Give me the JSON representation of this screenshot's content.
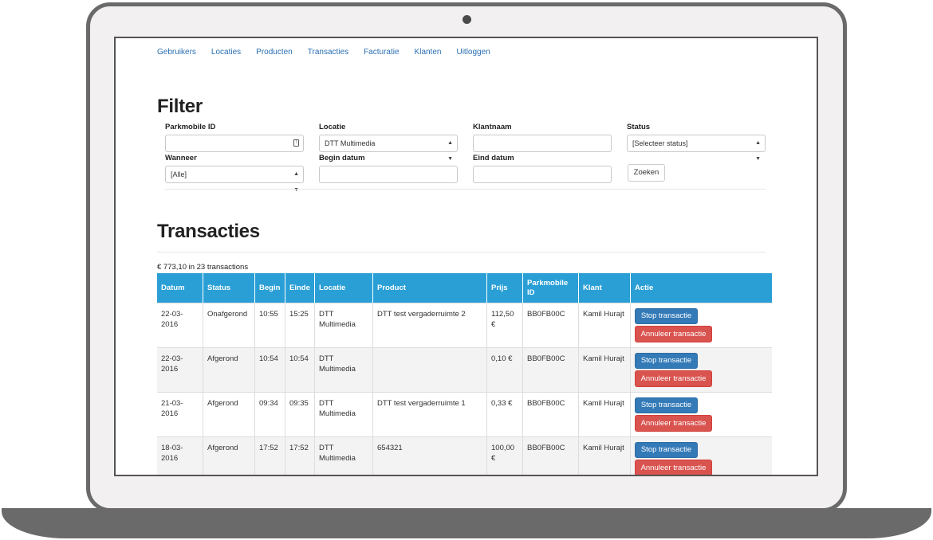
{
  "nav": [
    "Gebruikers",
    "Locaties",
    "Producten",
    "Transacties",
    "Facturatie",
    "Klanten",
    "Uitloggen"
  ],
  "filter": {
    "title": "Filter",
    "parkmobile_label": "Parkmobile ID",
    "parkmobile_value": "",
    "locatie_label": "Locatie",
    "locatie_value": "DTT Multimedia",
    "klantnaam_label": "Klantnaam",
    "klantnaam_value": "",
    "status_label": "Status",
    "status_value": "[Selecteer status]",
    "wanneer_label": "Wanneer",
    "wanneer_value": "[Alle]",
    "begin_label": "Begin datum",
    "begin_value": "",
    "eind_label": "Eind datum",
    "eind_value": "",
    "search_label": "Zoeken"
  },
  "transactions": {
    "title": "Transacties",
    "summary": "€ 773,10 in 23 transactions",
    "headers": [
      "Datum",
      "Status",
      "Begin",
      "Einde",
      "Locatie",
      "Product",
      "Prijs",
      "Parkmobile ID",
      "Klant",
      "Actie"
    ],
    "stop_label": "Stop transactie",
    "cancel_label": "Annuleer transactie",
    "rows": [
      {
        "datum": "22-03-2016",
        "status": "Onafgerond",
        "begin": "10:55",
        "einde": "15:25",
        "locatie": "DTT Multimedia",
        "product": "DTT test vergaderruimte 2",
        "prijs": "112,50 €",
        "parkmobile_id": "BB0FB00C",
        "klant": "Kamil Hurajt"
      },
      {
        "datum": "22-03-2016",
        "status": "Afgerond",
        "begin": "10:54",
        "einde": "10:54",
        "locatie": "DTT Multimedia",
        "product": "",
        "prijs": "0,10 €",
        "parkmobile_id": "BB0FB00C",
        "klant": "Kamil Hurajt"
      },
      {
        "datum": "21-03-2016",
        "status": "Afgerond",
        "begin": "09:34",
        "einde": "09:35",
        "locatie": "DTT Multimedia",
        "product": "DTT test vergaderruimte 1",
        "prijs": "0,33 €",
        "parkmobile_id": "BB0FB00C",
        "klant": "Kamil Hurajt"
      },
      {
        "datum": "18-03-2016",
        "status": "Afgerond",
        "begin": "17:52",
        "einde": "17:52",
        "locatie": "DTT Multimedia",
        "product": "654321",
        "prijs": "100,00 €",
        "parkmobile_id": "BB0FB00C",
        "klant": "Kamil Hurajt"
      }
    ]
  },
  "colors": {
    "header_bg": "#2a9fd6",
    "primary": "#337ab7",
    "danger": "#d9534f",
    "link": "#2a6fb3"
  }
}
